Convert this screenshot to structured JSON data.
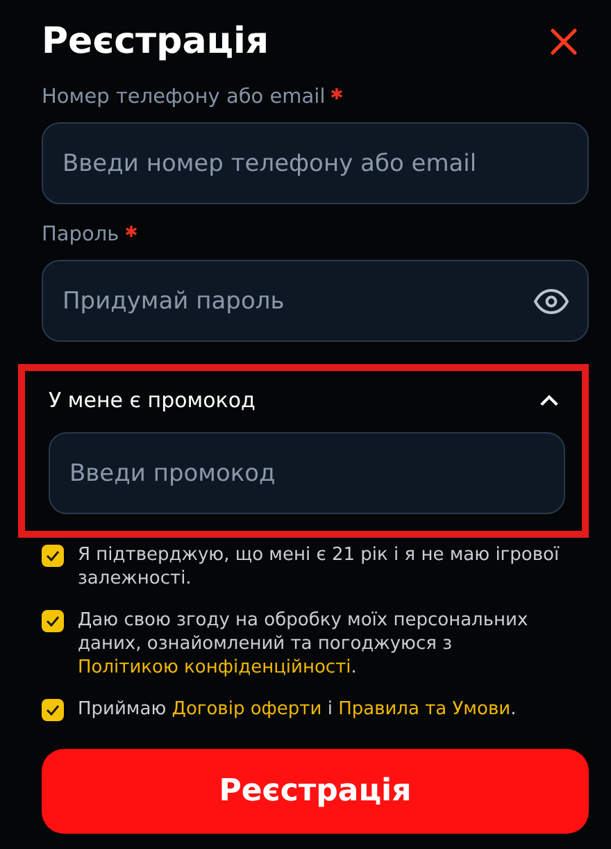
{
  "title": "Реєстрація",
  "fields": [
    {
      "label": "Номер телефону або email",
      "required": true,
      "placeholder": "Введи номер телефону або email",
      "eye": false
    },
    {
      "label": "Пароль",
      "required": true,
      "placeholder": "Придумай пароль",
      "eye": true
    }
  ],
  "promo": {
    "label": "У мене є промокод",
    "expanded": true,
    "highlighted": true,
    "placeholder": "Введи промокод"
  },
  "consents": [
    {
      "checked": true,
      "parts": [
        {
          "kind": "text",
          "text": "Я підтверджую, що мені є 21 рік і я не маю ігрової залежності."
        }
      ]
    },
    {
      "checked": true,
      "parts": [
        {
          "kind": "text",
          "text": "Даю свою згоду на обробку моїх персональних даних, ознайомлений та погоджуюся з "
        },
        {
          "kind": "link",
          "text": "Політикою конфіденційності"
        },
        {
          "kind": "text",
          "text": "."
        }
      ]
    },
    {
      "checked": true,
      "parts": [
        {
          "kind": "text",
          "text": "Приймаю "
        },
        {
          "kind": "link",
          "text": "Договір оферти"
        },
        {
          "kind": "text",
          "text": " і "
        },
        {
          "kind": "link",
          "text": "Правила та Умови"
        },
        {
          "kind": "text",
          "text": "."
        }
      ]
    }
  ],
  "submit": "Реєстрація"
}
